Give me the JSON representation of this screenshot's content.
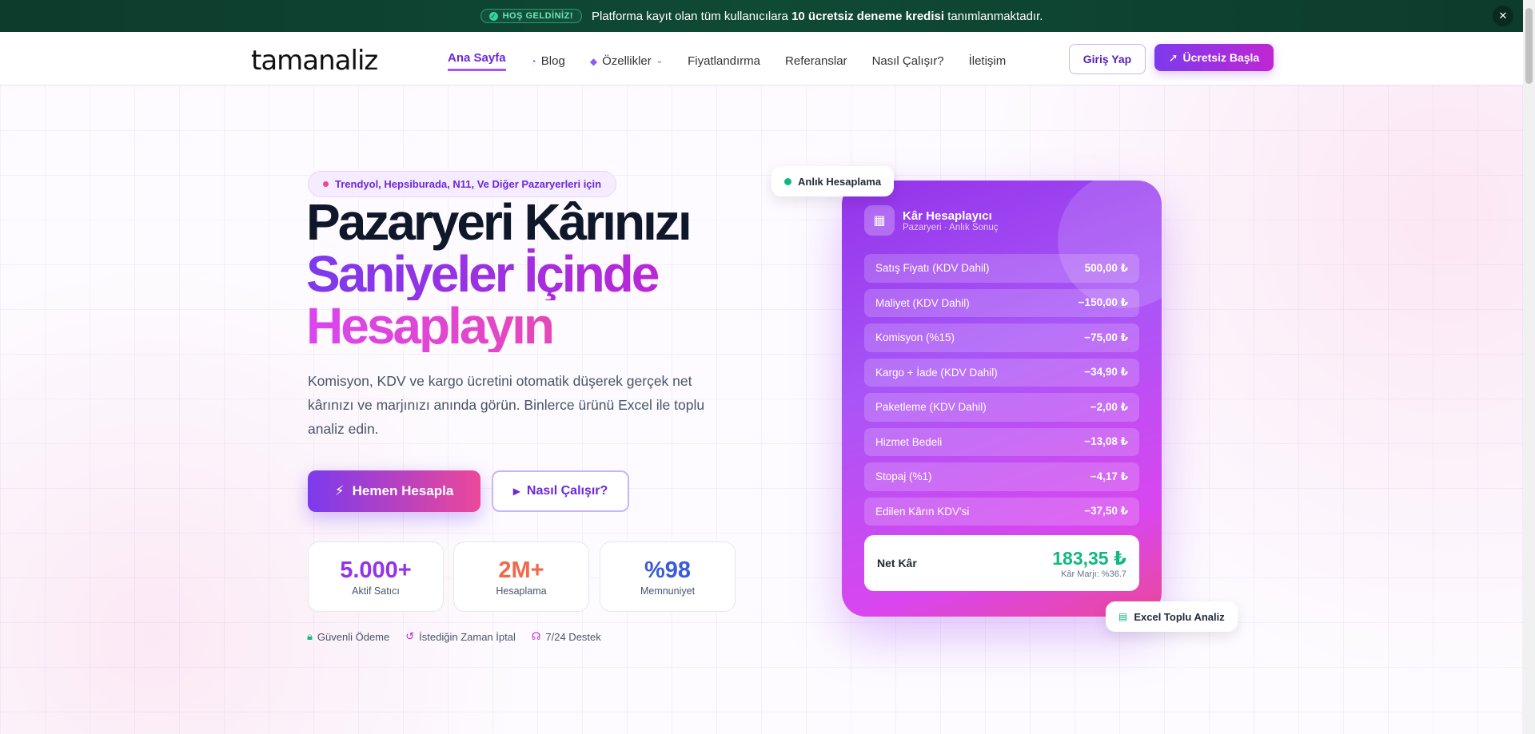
{
  "announcement": {
    "badge": "HOŞ GELDİNİZ!",
    "text_before": "Platforma kayıt olan tüm kullanıcılara",
    "text_bold": "10 ücretsiz deneme kredisi",
    "text_after": "tanımlanmaktadır.",
    "close": "✕"
  },
  "nav": {
    "logo": "tamanaliz",
    "links": [
      "Ana Sayfa",
      "Blog",
      "Özellikler",
      "Fiyatlandırma",
      "Referanslar",
      "Nasıl Çalışır?",
      "İletişim"
    ],
    "login": "Giriş Yap",
    "start": "Ücretsiz Başla"
  },
  "hero": {
    "pill": "Trendyol, Hepsiburada, N11, Ve Diğer Pazaryerleri için",
    "title_l1": "Pazaryeri Kârınızı",
    "title_l2": "Saniyeler İçinde",
    "title_l3": "Hesaplayın",
    "description": "Komisyon, KDV ve kargo ücretini otomatik düşerek gerçek net kârınızı ve marjınızı anında görün. Binlerce ürünü Excel ile toplu analiz edin.",
    "cta_primary": "Hemen Hesapla",
    "cta_secondary": "Nasıl Çalışır?",
    "stats": [
      {
        "num": "5.000+",
        "label": "Aktif Satıcı",
        "color": "#9333ea"
      },
      {
        "num": "2M+",
        "label": "Hesaplama",
        "color": "#ef6a4a"
      },
      {
        "num": "%98",
        "label": "Memnuniyet",
        "color": "#3b5bdb"
      }
    ],
    "trust": [
      "Güvenli Ödeme",
      "İstediğin Zaman İptal",
      "7/24 Destek"
    ]
  },
  "calculator": {
    "badge_top": "Anlık Hesaplama",
    "title": "Kâr Hesaplayıcı",
    "subtitle": "Pazaryeri · Anlık Sonuç",
    "rows": [
      {
        "label": "Satış Fiyatı (KDV Dahil)",
        "value": "500,00 ₺"
      },
      {
        "label": "Maliyet (KDV Dahil)",
        "value": "−150,00 ₺"
      },
      {
        "label": "Komisyon (%15)",
        "value": "−75,00 ₺"
      },
      {
        "label": "Kargo + İade (KDV Dahil)",
        "value": "−34,90 ₺"
      },
      {
        "label": "Paketleme (KDV Dahil)",
        "value": "−2,00 ₺"
      },
      {
        "label": "Hizmet Bedeli",
        "value": "−13,08 ₺"
      },
      {
        "label": "Stopaj (%1)",
        "value": "−4,17 ₺"
      },
      {
        "label": "Edilen Kârın KDV'si",
        "value": "−37,50 ₺"
      }
    ],
    "net_label": "Net Kâr",
    "net_value": "183,35 ₺",
    "margin": "Kâr Marjı: %36.7",
    "badge_bottom": "Excel Toplu Analiz"
  }
}
